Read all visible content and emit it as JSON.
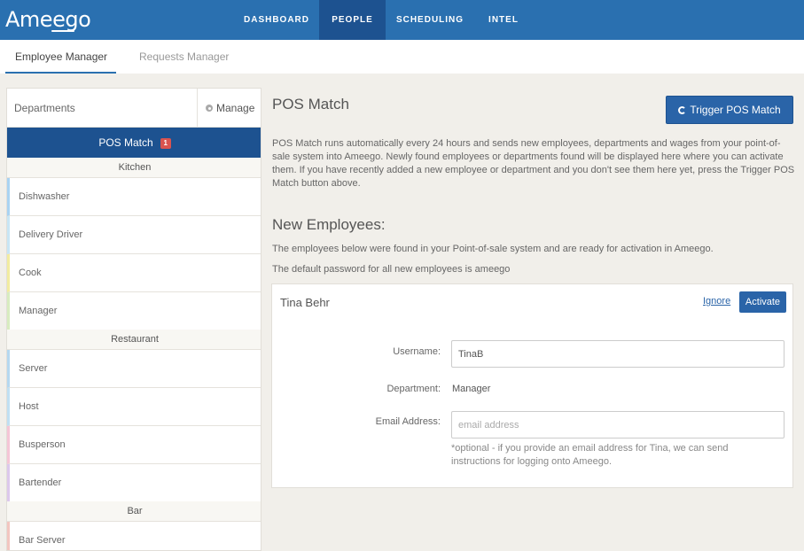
{
  "app": {
    "logo_text": "Ameego"
  },
  "nav": {
    "items": [
      {
        "label": "DASHBOARD"
      },
      {
        "label": "PEOPLE"
      },
      {
        "label": "SCHEDULING"
      },
      {
        "label": "INTEL"
      }
    ],
    "active": "PEOPLE"
  },
  "subtabs": [
    {
      "label": "Employee Manager"
    },
    {
      "label": "Requests Manager"
    }
  ],
  "sidebar": {
    "title": "Departments",
    "manage_label": "Manage",
    "pos_match_label": "POS Match",
    "pos_match_badge": "1",
    "groups": [
      {
        "name": "Kitchen",
        "items": [
          "Dishwasher",
          "Delivery Driver",
          "Cook",
          "Manager"
        ]
      },
      {
        "name": "Restaurant",
        "items": [
          "Server",
          "Host",
          "Busperson",
          "Bartender"
        ]
      },
      {
        "name": "Bar",
        "items": [
          "Bar Server"
        ]
      }
    ]
  },
  "main": {
    "title": "POS Match",
    "trigger_label": "Trigger POS Match",
    "description": "POS Match runs automatically every 24 hours and sends new employees, departments and wages from your point-of-sale system into Ameego. Newly found employees or departments found will be displayed here where you can activate them. If you have recently added a new employee or department and you don't see them here yet, press the Trigger POS Match button above.",
    "new_employees_title": "New Employees:",
    "info_line_1": "The employees below were found in your Point-of-sale system and are ready for activation in Ameego.",
    "info_line_2": "The default password for all new employees is ameego",
    "employee": {
      "name": "Tina Behr",
      "ignore_label": "Ignore",
      "activate_label": "Activate",
      "username_label": "Username:",
      "username_value": "TinaB",
      "department_label": "Department:",
      "department_value": "Manager",
      "email_label": "Email Address:",
      "email_placeholder": "email address",
      "help_text": "*optional - if you provide an email address for Tina, we can send instructions for logging onto Ameego."
    }
  },
  "colors": {
    "nav_bg": "#2a70b0",
    "nav_active": "#1d5290",
    "badge": "#d9534f"
  }
}
